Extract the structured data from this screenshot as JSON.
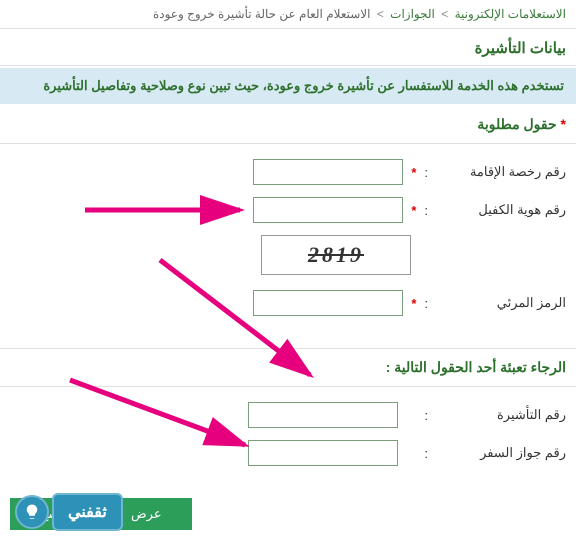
{
  "breadcrumb": {
    "item1": "الاستعلامات الإلكترونية",
    "item2": "الجوازات",
    "current": "الاستعلام العام عن حالة تأشيرة خروج وعودة"
  },
  "section_title": "بيانات التأشيرة",
  "info_text": "تستخدم هذه الخدمة للاستفسار عن تأشيرة خروج وعودة، حيث تبين نوع وصلاحية وتفاصيل التأشيرة",
  "required_title": "حقول مطلوبة",
  "fields": {
    "iqama": "رقم رخصة الإقامة",
    "sponsor": "رقم هوية الكفيل",
    "captcha_label": "الرمز المرئي",
    "captcha_value": "2819",
    "visa": "رقم التأشيرة",
    "passport": "رقم جواز السفر"
  },
  "fill_one": "الرجاء تعبئة أحد الحقول التالية :",
  "buttons": {
    "view": "عرض",
    "clear": "مسح"
  },
  "logo_text": "ثقفني"
}
